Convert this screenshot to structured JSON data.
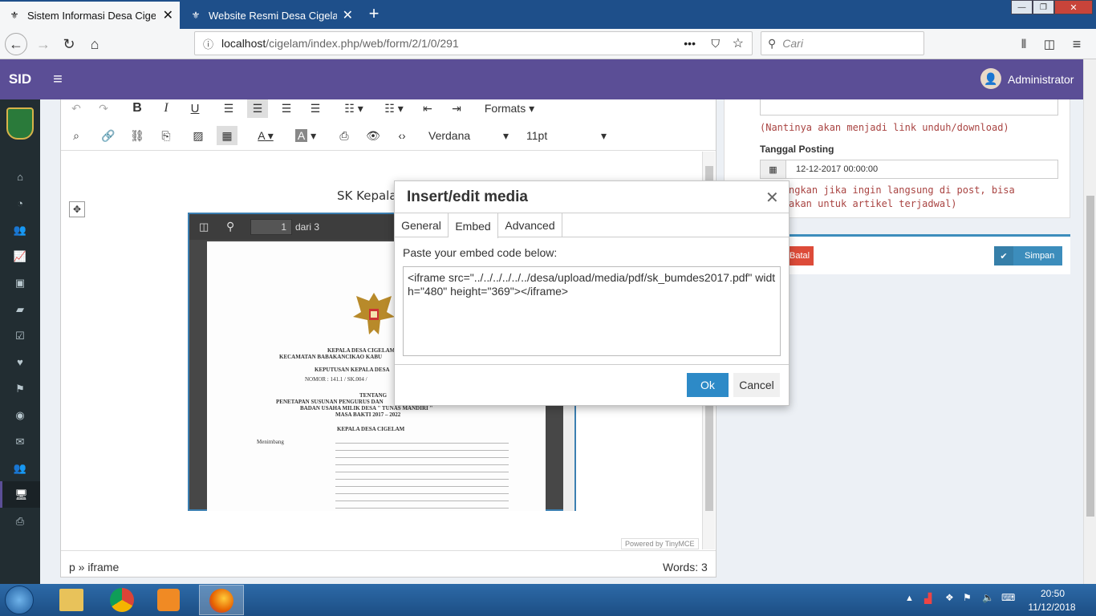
{
  "browser": {
    "tabs": [
      {
        "title": "Sistem Informasi Desa Cigelam",
        "active": true
      },
      {
        "title": "Website Resmi Desa Cigelam -",
        "active": false
      }
    ],
    "new_tab": "+",
    "url_prefix": "localhost",
    "url_path": "/cigelam/index.php/web/form/2/1/0/291",
    "search_placeholder": "Cari",
    "window_controls": [
      "—",
      "❐",
      "✕"
    ]
  },
  "app": {
    "brand": "SID",
    "menu_toggle": "≡",
    "user_name": "Administrator"
  },
  "editor": {
    "formats_label": "Formats",
    "font_family": "Verdana",
    "font_size": "11pt",
    "content_heading": "SK Kepala",
    "pdf_toolbar": {
      "page": "1",
      "of": "dari 3"
    },
    "document_lines": [
      "KEPALA DESA CIGELAM",
      "KECAMATAN BABAKANCIKAO KABU",
      "KEPUTUSAN KEPALA DESA",
      "NOMOR : 141.1 / SK.004 /",
      "TENTANG",
      "PENETAPAN SUSUNAN PENGURUS DAN",
      "BADAN USAHA MILIK DESA \" TUNAS MANDIRI \"",
      "MASA BAKTI 2017 – 2022",
      "KEPALA DESA CIGELAM",
      "Menimbang"
    ],
    "status_path": "p » iframe",
    "word_count": "Words: 3",
    "powered_by": "Powered by TinyMCE"
  },
  "right_panel": {
    "note1": "(Nantinya akan menjadi link unduh/download)",
    "posting_label": "Tanggal Posting",
    "posting_value": "12-12-2017 00:00:00",
    "note2_line1": "ngkan jika ingin langsung di post, bisa",
    "note2_line2": "akan untuk artikel terjadwal)",
    "batal": "Batal",
    "simpan": "Simpan"
  },
  "modal": {
    "title": "Insert/edit media",
    "tabs": [
      "General",
      "Embed",
      "Advanced"
    ],
    "active_tab": "Embed",
    "instruction": "Paste your embed code below:",
    "embed_code": "<iframe src=\"../../../../../../desa/upload/media/pdf/sk_bumdes2017.pdf\" width=\"480\" height=\"369\"></iframe>",
    "ok": "Ok",
    "cancel": "Cancel"
  },
  "taskbar": {
    "time": "20:50",
    "date": "11/12/2018"
  },
  "colors": {
    "header": "#5b4e96",
    "sidebar": "#222d32",
    "ok_button": "#2d8ac7",
    "batal": "#dd4b39",
    "simpan": "#3c8dbc",
    "note": "#a94442"
  }
}
